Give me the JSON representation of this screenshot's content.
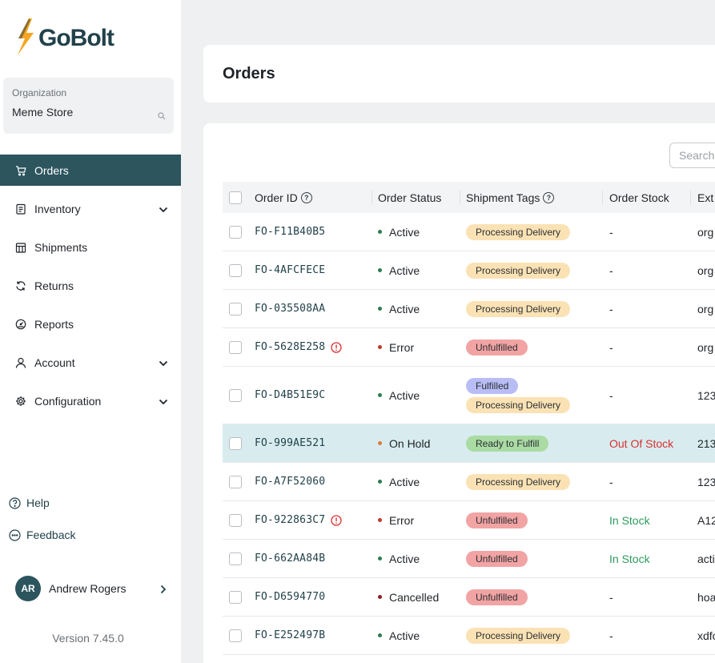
{
  "brand": {
    "logo_text": "GoBolt",
    "accent": "#2c555e",
    "bolt_color": "#f5a623"
  },
  "organization": {
    "label": "Organization",
    "name": "Meme Store"
  },
  "nav": [
    {
      "label": "Orders",
      "icon": "cart-icon",
      "active": true,
      "expandable": false
    },
    {
      "label": "Inventory",
      "icon": "clipboard-icon",
      "active": false,
      "expandable": true
    },
    {
      "label": "Shipments",
      "icon": "building-icon",
      "active": false,
      "expandable": false
    },
    {
      "label": "Returns",
      "icon": "refresh-icon",
      "active": false,
      "expandable": false
    },
    {
      "label": "Reports",
      "icon": "gauge-icon",
      "active": false,
      "expandable": false
    },
    {
      "label": "Account",
      "icon": "user-icon",
      "active": false,
      "expandable": true
    },
    {
      "label": "Configuration",
      "icon": "gear-icon",
      "active": false,
      "expandable": true
    }
  ],
  "footer_links": {
    "help": "Help",
    "feedback": "Feedback"
  },
  "user": {
    "initials": "AR",
    "name": "Andrew Rogers"
  },
  "version": "Version 7.45.0",
  "page": {
    "title": "Orders"
  },
  "search": {
    "placeholder": "Search"
  },
  "table": {
    "columns": [
      "Order ID",
      "Order Status",
      "Shipment Tags",
      "Order Stock",
      "Ext"
    ],
    "rows": [
      {
        "id": "FO-F11B40B5",
        "error": false,
        "status": "Active",
        "tags": [
          "Processing Delivery"
        ],
        "stock": "-",
        "ext": "org"
      },
      {
        "id": "FO-4AFCFECE",
        "error": false,
        "status": "Active",
        "tags": [
          "Processing Delivery"
        ],
        "stock": "-",
        "ext": "org"
      },
      {
        "id": "FO-035508AA",
        "error": false,
        "status": "Active",
        "tags": [
          "Processing Delivery"
        ],
        "stock": "-",
        "ext": "org"
      },
      {
        "id": "FO-5628E258",
        "error": true,
        "status": "Error",
        "tags": [
          "Unfulfilled"
        ],
        "stock": "-",
        "ext": "org"
      },
      {
        "id": "FO-D4B51E9C",
        "error": false,
        "status": "Active",
        "tags": [
          "Fulfilled",
          "Processing Delivery"
        ],
        "stock": "-",
        "ext": "123"
      },
      {
        "id": "FO-999AE521",
        "error": false,
        "status": "On Hold",
        "tags": [
          "Ready to Fulfill"
        ],
        "stock": "Out Of Stock",
        "ext": "213",
        "highlight": true
      },
      {
        "id": "FO-A7F52060",
        "error": false,
        "status": "Active",
        "tags": [
          "Processing Delivery"
        ],
        "stock": "-",
        "ext": "123"
      },
      {
        "id": "FO-922863C7",
        "error": true,
        "status": "Error",
        "tags": [
          "Unfulfilled"
        ],
        "stock": "In Stock",
        "ext": "A12"
      },
      {
        "id": "FO-662AA84B",
        "error": false,
        "status": "Active",
        "tags": [
          "Unfulfilled"
        ],
        "stock": "In Stock",
        "ext": "acti"
      },
      {
        "id": "FO-D6594770",
        "error": false,
        "status": "Cancelled",
        "tags": [
          "Unfulfilled"
        ],
        "stock": "-",
        "ext": "hoa"
      },
      {
        "id": "FO-E252497B",
        "error": false,
        "status": "Active",
        "tags": [
          "Processing Delivery"
        ],
        "stock": "-",
        "ext": "xdfo"
      }
    ]
  },
  "colors": {
    "status": {
      "Active": "#2e7d4f",
      "Error": "#c0392b",
      "On Hold": "#e07b39",
      "Cancelled": "#8b1e2b"
    },
    "tags": {
      "Processing Delivery": "#fbe2b4",
      "Unfulfilled": "#f2a3a3",
      "Fulfilled": "#b9bdf5",
      "Ready to Fulfill": "#a9dba3"
    }
  }
}
